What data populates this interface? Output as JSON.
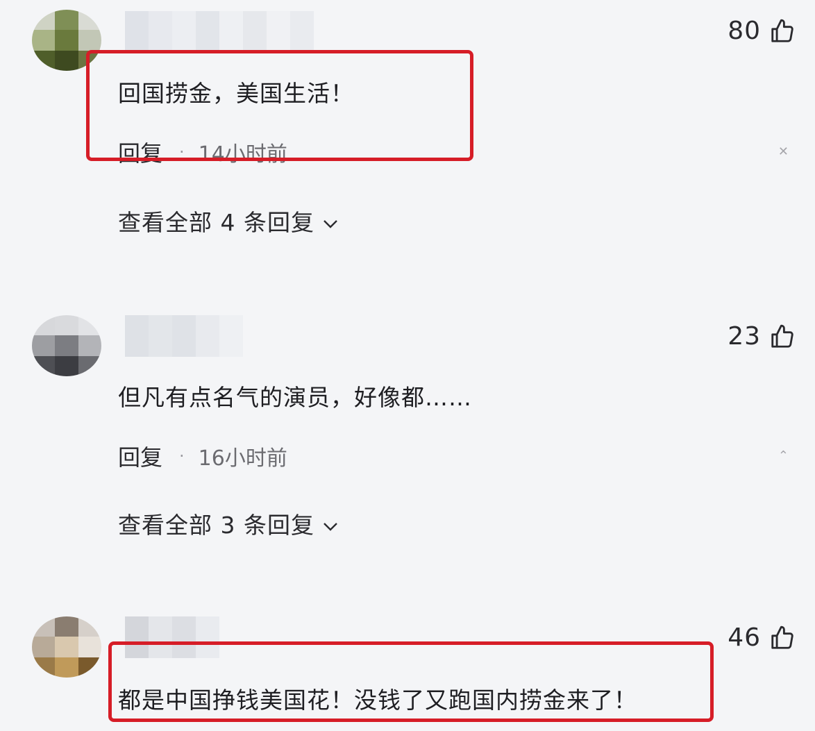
{
  "comments": [
    {
      "likes": "80",
      "text": "回国捞金，美国生活！",
      "reply_label": "回复",
      "separator": "·",
      "time": "14小时前",
      "view_replies": "查看全部 4 条回复"
    },
    {
      "likes": "23",
      "text": "但凡有点名气的演员，好像都……",
      "reply_label": "回复",
      "separator": "·",
      "time": "16小时前",
      "view_replies": "查看全部 3 条回复"
    },
    {
      "likes": "46",
      "text": "都是中国挣钱美国花！没钱了又跑国内捞金来了！"
    }
  ],
  "icons": {
    "like": "thumbs-up-icon",
    "more": "collapse-icon",
    "expand": "chevron-down-icon"
  },
  "colors": {
    "background": "#f4f5f7",
    "highlight": "#d61d27"
  }
}
